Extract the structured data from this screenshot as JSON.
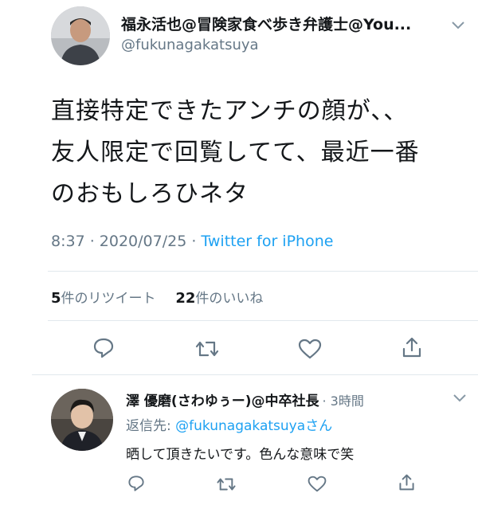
{
  "tweet": {
    "author_name": "福永活也@冒険家食べ歩き弁護士@You...",
    "author_handle": "@fukunagakatsuya",
    "text_lines": [
      "直接特定できたアンチの顔が、、",
      "友人限定で回覧してて、最近一番",
      "のおもしろひネタ"
    ],
    "time": "8:37 · 2020/07/25 · ",
    "source": "Twitter for iPhone",
    "retweet_count": "5",
    "retweet_label": "件のリツイート",
    "like_count": "22",
    "like_label": "件のいいね"
  },
  "reply": {
    "author_name": "澤 優磨(さわゆぅー)@中卒社長",
    "time": "· 3時間",
    "reply_to_prefix": "返信先: ",
    "reply_to_handle": "@fukunagakatsuya",
    "reply_to_suffix": "さん",
    "text": "晒して頂きたいです。色んな意味で笑"
  },
  "icons": {
    "reply": "reply-icon",
    "retweet": "retweet-icon",
    "like": "heart-icon",
    "share": "share-icon",
    "menu": "chevron-down-icon"
  },
  "colors": {
    "link": "#1da1f2",
    "secondary_text": "#657786",
    "icon": "#657786",
    "divider": "#e1e8ed"
  }
}
